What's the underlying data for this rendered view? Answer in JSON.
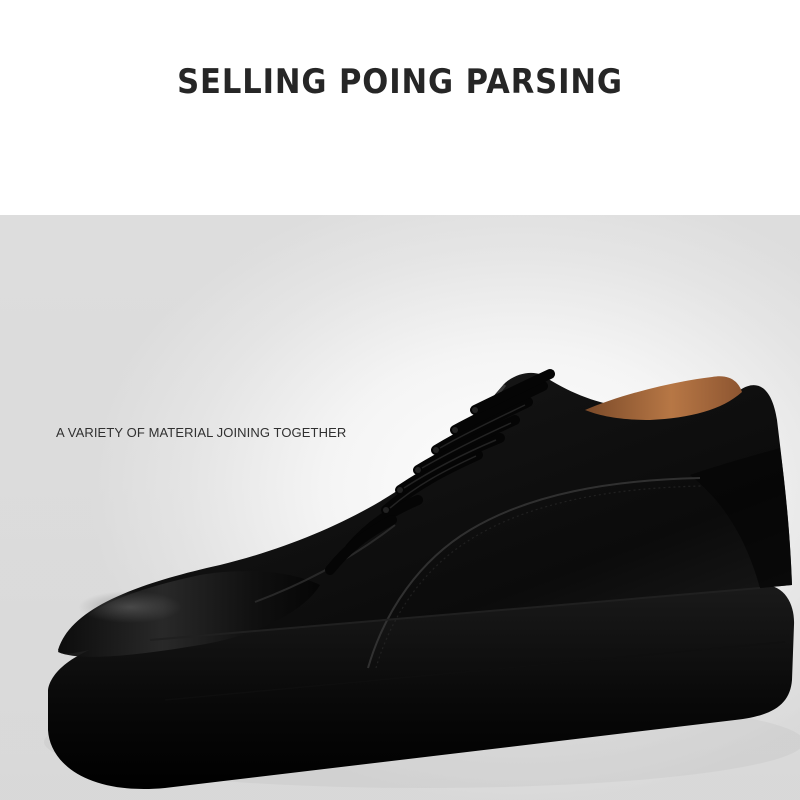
{
  "headline": "SELLING POING PARSING",
  "caption": "A VARIETY OF MATERIAL JOINING TOGETHER",
  "colors": {
    "page_background": "#ffffff",
    "photo_background": "#eeeeee",
    "shoe_leather": "#111111",
    "shoe_lining": "#a8693a",
    "laces": "#050505"
  },
  "image_subject": "shoe-icon"
}
